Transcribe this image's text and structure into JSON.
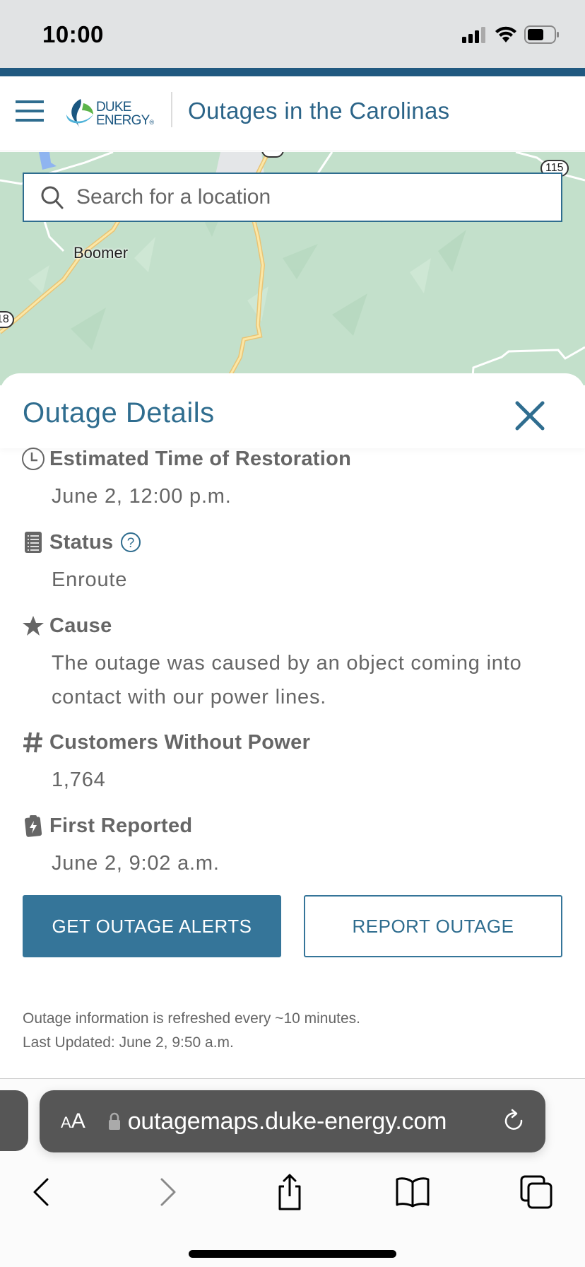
{
  "status_bar": {
    "time": "10:00",
    "icons": [
      "cellular-signal-icon",
      "wifi-icon",
      "battery-icon"
    ]
  },
  "header": {
    "menu_icon": "hamburger-menu-icon",
    "logo_line1": "DUKE",
    "logo_line2": "ENERGY",
    "logo_reg": "®",
    "title": "Outages in the Carolinas",
    "brand_color": "#215980"
  },
  "map": {
    "labels": [
      "Boomer"
    ],
    "route_shields": [
      "115",
      "18"
    ],
    "search": {
      "placeholder": "Search for a location",
      "value": ""
    }
  },
  "panel": {
    "title": "Outage Details",
    "close_icon": "close-icon",
    "details": [
      {
        "icon": "clock-icon",
        "label": "Estimated Time of Restoration",
        "value": "June 2, 12:00 p.m."
      },
      {
        "icon": "list-icon",
        "label": "Status",
        "value": "Enroute",
        "help_icon": "question-circle-icon"
      },
      {
        "icon": "star-icon",
        "label": "Cause",
        "value": "The outage was caused by an object coming into contact with our power lines."
      },
      {
        "icon": "hash-icon",
        "label": "Customers Without Power",
        "value": "1,764"
      },
      {
        "icon": "clipboard-bolt-icon",
        "label": "First Reported",
        "value": "June 2, 9:02 a.m."
      }
    ],
    "buttons": {
      "alerts": "GET OUTAGE ALERTS",
      "report": "REPORT OUTAGE"
    },
    "footnote_line1": "Outage information is refreshed every ~10 minutes.",
    "footnote_line2": "Last Updated: June 2, 9:50 a.m.",
    "accent_color": "#357599"
  },
  "browser": {
    "aa_small": "A",
    "aa_large": "A",
    "url": "outagemaps.duke-energy.com",
    "toolbar": [
      "back-icon",
      "forward-icon",
      "share-icon",
      "bookmarks-icon",
      "tabs-icon"
    ]
  }
}
